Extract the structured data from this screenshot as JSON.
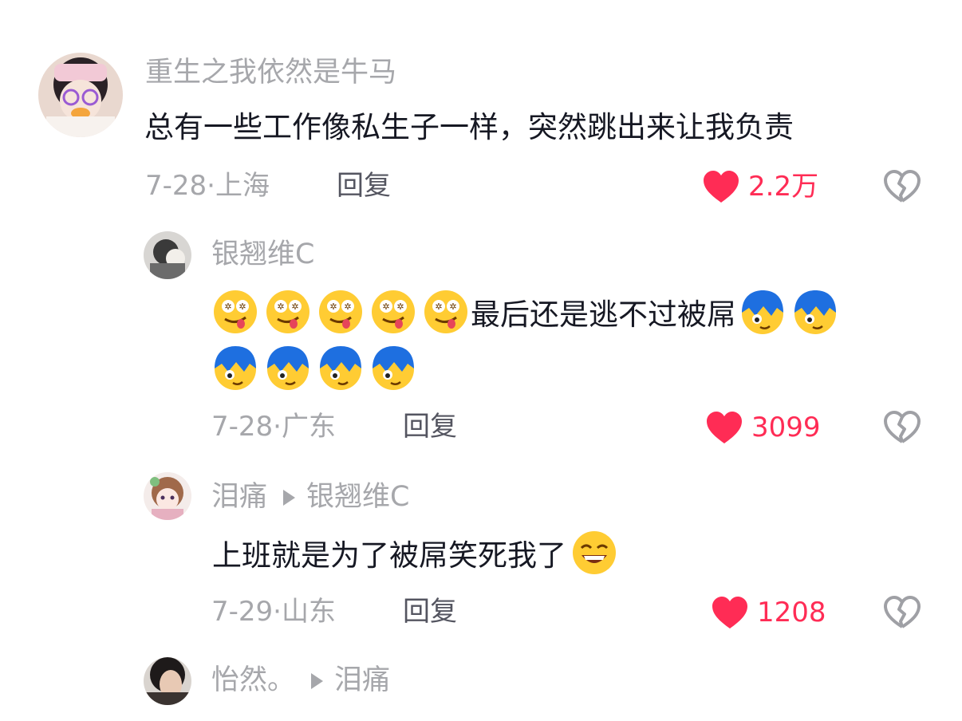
{
  "comments": [
    {
      "user": "重生之我依然是牛马",
      "text": "总有一些工作像私生子一样，突然跳出来让我负责",
      "date": "7-28",
      "location": "上海",
      "reply_label": "回复",
      "likes": "2.2万"
    },
    {
      "user": "银翘维C",
      "text": "最后还是逃不过被屌",
      "date": "7-28",
      "location": "广东",
      "reply_label": "回复",
      "likes": "3099",
      "emojis_before": [
        "drooling-star-eyes-emoji",
        "drooling-star-eyes-emoji",
        "drooling-star-eyes-emoji",
        "drooling-star-eyes-emoji",
        "drooling-star-eyes-emoji"
      ],
      "emojis_after": [
        "blue-hair-peek-emoji",
        "blue-hair-peek-emoji",
        "blue-hair-peek-emoji",
        "blue-hair-peek-emoji",
        "blue-hair-peek-emoji",
        "blue-hair-peek-emoji"
      ]
    },
    {
      "user": "泪痛",
      "reply_to": "银翘维C",
      "text": "上班就是为了被屌笑死我了",
      "date": "7-29",
      "location": "山东",
      "reply_label": "回复",
      "likes": "1208",
      "emojis_after": [
        "grinning-emoji"
      ]
    },
    {
      "user": "怡然。",
      "reply_to": "泪痛"
    }
  ],
  "colors": {
    "like": "#ff2c55",
    "meta": "#a6a7ab",
    "text": "#161823"
  },
  "icons": {
    "like": "heart-icon",
    "dislike": "broken-heart-icon",
    "reply_arrow": "triangle-right-icon"
  }
}
